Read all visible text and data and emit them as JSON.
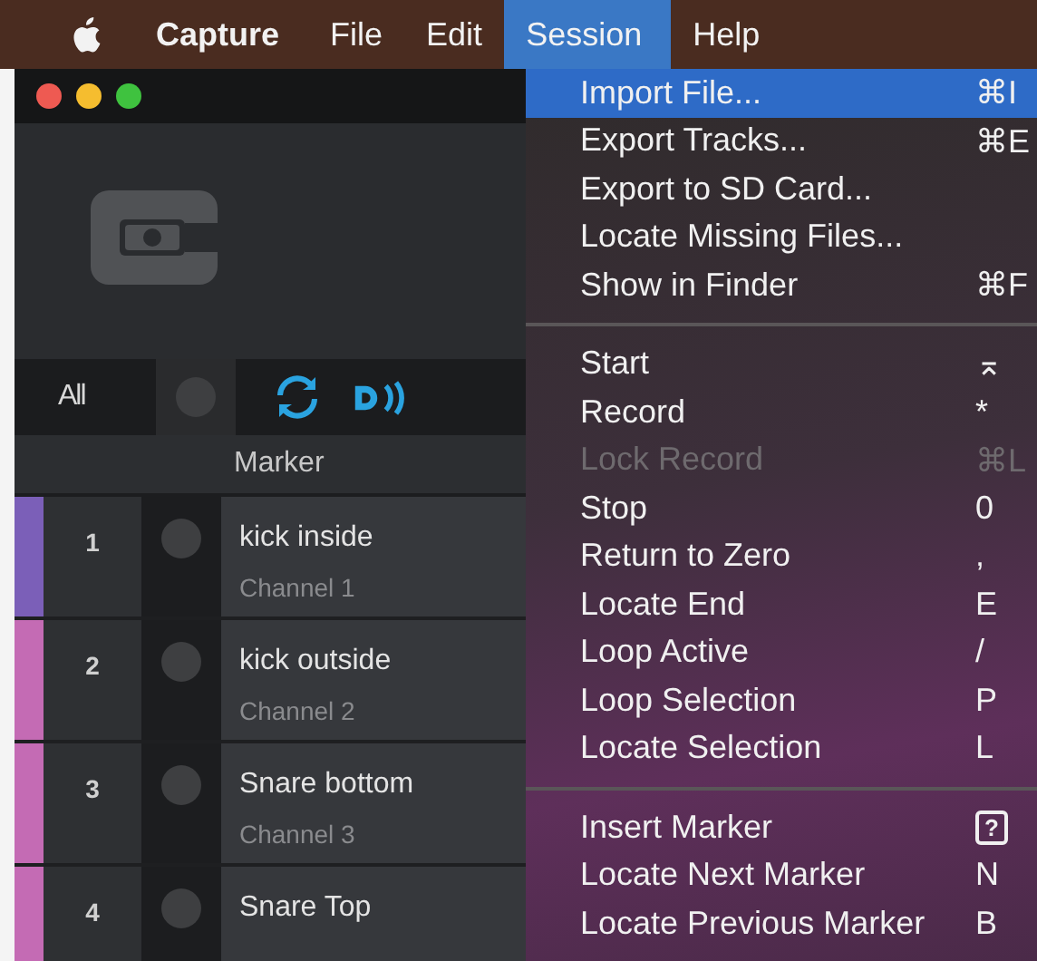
{
  "menu_bar": {
    "items": [
      {
        "label": "Capture",
        "kind": "app",
        "selected": false
      },
      {
        "label": "File",
        "kind": "menu",
        "selected": false
      },
      {
        "label": "Edit",
        "kind": "menu",
        "selected": false
      },
      {
        "label": "Session",
        "kind": "menu",
        "selected": true
      },
      {
        "label": "Help",
        "kind": "menu",
        "selected": false
      }
    ]
  },
  "toolbar": {
    "filter": "All"
  },
  "track_list": {
    "columns": [
      "Marker"
    ],
    "rows": [
      {
        "number": "1",
        "name": "kick inside",
        "channel": "Channel 1",
        "color": "#7b5fb8"
      },
      {
        "number": "2",
        "name": "kick outside",
        "channel": "Channel 2",
        "color": "#c46bb4"
      },
      {
        "number": "3",
        "name": "Snare bottom",
        "channel": "Channel 3",
        "color": "#c46bb4"
      },
      {
        "number": "4",
        "name": "Snare Top",
        "color": "#c46bb4"
      }
    ]
  },
  "session_menu": {
    "items": [
      {
        "kind": "item",
        "label": "Import File...",
        "shortcut": "⌘I",
        "selected": true,
        "disabled": false
      },
      {
        "kind": "item",
        "label": "Export Tracks...",
        "shortcut": "⌘E",
        "selected": false,
        "disabled": false
      },
      {
        "kind": "item",
        "label": "Export to SD Card...",
        "selected": false,
        "disabled": false
      },
      {
        "kind": "item",
        "label": "Locate Missing Files...",
        "selected": false,
        "disabled": false
      },
      {
        "kind": "item",
        "label": "Show in Finder",
        "shortcut": "⌘F",
        "selected": false,
        "disabled": false
      },
      {
        "kind": "separator"
      },
      {
        "kind": "item",
        "label": "Start",
        "shortcut": "⌅",
        "selected": false,
        "disabled": false
      },
      {
        "kind": "item",
        "label": "Record",
        "shortcut": "*",
        "selected": false,
        "disabled": false
      },
      {
        "kind": "item",
        "label": "Lock Record",
        "shortcut": "⌘L",
        "selected": false,
        "disabled": true
      },
      {
        "kind": "item",
        "label": "Stop",
        "shortcut": "0",
        "selected": false,
        "disabled": false
      },
      {
        "kind": "item",
        "label": "Return to Zero",
        "shortcut": ",",
        "selected": false,
        "disabled": false
      },
      {
        "kind": "item",
        "label": "Locate End",
        "shortcut": "E",
        "selected": false,
        "disabled": false
      },
      {
        "kind": "item",
        "label": "Loop Active",
        "shortcut": "/",
        "selected": false,
        "disabled": false
      },
      {
        "kind": "item",
        "label": "Loop Selection",
        "shortcut": "P",
        "selected": false,
        "disabled": false
      },
      {
        "kind": "item",
        "label": "Locate Selection",
        "shortcut": "L",
        "selected": false,
        "disabled": false
      },
      {
        "kind": "separator"
      },
      {
        "kind": "item",
        "label": "Insert Marker",
        "shortcut": "?",
        "shortcut_boxed": true,
        "selected": false,
        "disabled": false
      },
      {
        "kind": "item",
        "label": "Locate Next Marker",
        "shortcut": "N",
        "selected": false,
        "disabled": false
      },
      {
        "kind": "item",
        "label": "Locate Previous Marker",
        "shortcut": "B",
        "selected": false,
        "disabled": false
      }
    ]
  }
}
